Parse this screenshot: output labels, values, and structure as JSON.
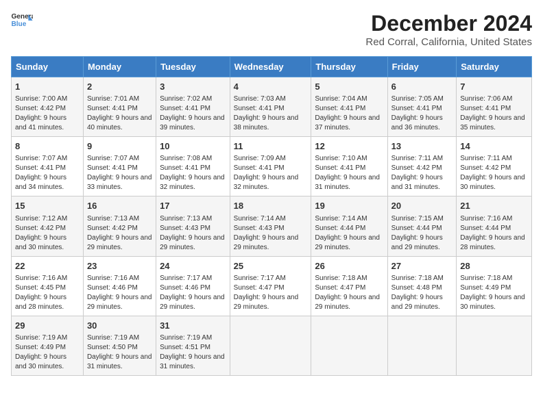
{
  "logo": {
    "line1": "General",
    "line2": "Blue"
  },
  "title": "December 2024",
  "subtitle": "Red Corral, California, United States",
  "days_header": [
    "Sunday",
    "Monday",
    "Tuesday",
    "Wednesday",
    "Thursday",
    "Friday",
    "Saturday"
  ],
  "weeks": [
    [
      {
        "day": "1",
        "sunrise": "7:00 AM",
        "sunset": "4:42 PM",
        "daylight": "9 hours and 41 minutes."
      },
      {
        "day": "2",
        "sunrise": "7:01 AM",
        "sunset": "4:41 PM",
        "daylight": "9 hours and 40 minutes."
      },
      {
        "day": "3",
        "sunrise": "7:02 AM",
        "sunset": "4:41 PM",
        "daylight": "9 hours and 39 minutes."
      },
      {
        "day": "4",
        "sunrise": "7:03 AM",
        "sunset": "4:41 PM",
        "daylight": "9 hours and 38 minutes."
      },
      {
        "day": "5",
        "sunrise": "7:04 AM",
        "sunset": "4:41 PM",
        "daylight": "9 hours and 37 minutes."
      },
      {
        "day": "6",
        "sunrise": "7:05 AM",
        "sunset": "4:41 PM",
        "daylight": "9 hours and 36 minutes."
      },
      {
        "day": "7",
        "sunrise": "7:06 AM",
        "sunset": "4:41 PM",
        "daylight": "9 hours and 35 minutes."
      }
    ],
    [
      {
        "day": "8",
        "sunrise": "7:07 AM",
        "sunset": "4:41 PM",
        "daylight": "9 hours and 34 minutes."
      },
      {
        "day": "9",
        "sunrise": "7:07 AM",
        "sunset": "4:41 PM",
        "daylight": "9 hours and 33 minutes."
      },
      {
        "day": "10",
        "sunrise": "7:08 AM",
        "sunset": "4:41 PM",
        "daylight": "9 hours and 32 minutes."
      },
      {
        "day": "11",
        "sunrise": "7:09 AM",
        "sunset": "4:41 PM",
        "daylight": "9 hours and 32 minutes."
      },
      {
        "day": "12",
        "sunrise": "7:10 AM",
        "sunset": "4:41 PM",
        "daylight": "9 hours and 31 minutes."
      },
      {
        "day": "13",
        "sunrise": "7:11 AM",
        "sunset": "4:42 PM",
        "daylight": "9 hours and 31 minutes."
      },
      {
        "day": "14",
        "sunrise": "7:11 AM",
        "sunset": "4:42 PM",
        "daylight": "9 hours and 30 minutes."
      }
    ],
    [
      {
        "day": "15",
        "sunrise": "7:12 AM",
        "sunset": "4:42 PM",
        "daylight": "9 hours and 30 minutes."
      },
      {
        "day": "16",
        "sunrise": "7:13 AM",
        "sunset": "4:42 PM",
        "daylight": "9 hours and 29 minutes."
      },
      {
        "day": "17",
        "sunrise": "7:13 AM",
        "sunset": "4:43 PM",
        "daylight": "9 hours and 29 minutes."
      },
      {
        "day": "18",
        "sunrise": "7:14 AM",
        "sunset": "4:43 PM",
        "daylight": "9 hours and 29 minutes."
      },
      {
        "day": "19",
        "sunrise": "7:14 AM",
        "sunset": "4:44 PM",
        "daylight": "9 hours and 29 minutes."
      },
      {
        "day": "20",
        "sunrise": "7:15 AM",
        "sunset": "4:44 PM",
        "daylight": "9 hours and 29 minutes."
      },
      {
        "day": "21",
        "sunrise": "7:16 AM",
        "sunset": "4:44 PM",
        "daylight": "9 hours and 28 minutes."
      }
    ],
    [
      {
        "day": "22",
        "sunrise": "7:16 AM",
        "sunset": "4:45 PM",
        "daylight": "9 hours and 28 minutes."
      },
      {
        "day": "23",
        "sunrise": "7:16 AM",
        "sunset": "4:46 PM",
        "daylight": "9 hours and 29 minutes."
      },
      {
        "day": "24",
        "sunrise": "7:17 AM",
        "sunset": "4:46 PM",
        "daylight": "9 hours and 29 minutes."
      },
      {
        "day": "25",
        "sunrise": "7:17 AM",
        "sunset": "4:47 PM",
        "daylight": "9 hours and 29 minutes."
      },
      {
        "day": "26",
        "sunrise": "7:18 AM",
        "sunset": "4:47 PM",
        "daylight": "9 hours and 29 minutes."
      },
      {
        "day": "27",
        "sunrise": "7:18 AM",
        "sunset": "4:48 PM",
        "daylight": "9 hours and 29 minutes."
      },
      {
        "day": "28",
        "sunrise": "7:18 AM",
        "sunset": "4:49 PM",
        "daylight": "9 hours and 30 minutes."
      }
    ],
    [
      {
        "day": "29",
        "sunrise": "7:19 AM",
        "sunset": "4:49 PM",
        "daylight": "9 hours and 30 minutes."
      },
      {
        "day": "30",
        "sunrise": "7:19 AM",
        "sunset": "4:50 PM",
        "daylight": "9 hours and 31 minutes."
      },
      {
        "day": "31",
        "sunrise": "7:19 AM",
        "sunset": "4:51 PM",
        "daylight": "9 hours and 31 minutes."
      },
      null,
      null,
      null,
      null
    ]
  ]
}
